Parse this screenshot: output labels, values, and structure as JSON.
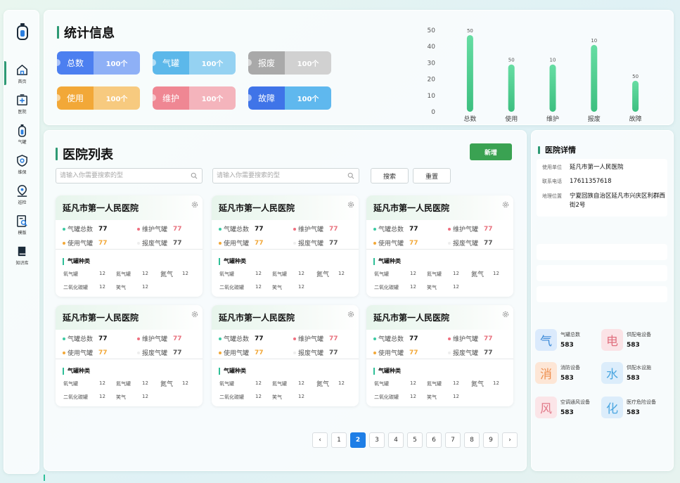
{
  "sidebar": {
    "items": [
      {
        "label": "首页",
        "icon": "home-icon",
        "active": true
      },
      {
        "label": "医院",
        "icon": "hospital-icon"
      },
      {
        "label": "气罐",
        "icon": "gas-tank-icon"
      },
      {
        "label": "维保",
        "icon": "maintenance-icon"
      },
      {
        "label": "巡检",
        "icon": "inspection-icon"
      },
      {
        "label": "模版",
        "icon": "template-icon"
      },
      {
        "label": "知识库",
        "icon": "book-icon"
      }
    ]
  },
  "stats": {
    "title": "统计信息",
    "pills": [
      {
        "label": "总数",
        "value": "100个",
        "left_color": "#4c7ff0",
        "right_color": "#8eb0f6"
      },
      {
        "label": "气罐",
        "value": "100个",
        "left_color": "#5cb8ea",
        "right_color": "#95d2f2"
      },
      {
        "label": "报废",
        "value": "100个",
        "left_color": "#a9a9a9",
        "right_color": "#d1d1d1"
      },
      {
        "label": "使用",
        "value": "100个",
        "left_color": "#f2a838",
        "right_color": "#f7ca7f"
      },
      {
        "label": "维护",
        "value": "100个",
        "left_color": "#ef8793",
        "right_color": "#f4b4bc"
      },
      {
        "label": "故障",
        "value": "100个",
        "left_color": "#3f74e8",
        "right_color": "#5fb8ee"
      }
    ]
  },
  "chart_data": {
    "type": "bar",
    "categories": [
      "总数",
      "使用",
      "维护",
      "报废",
      "故障"
    ],
    "values": [
      47,
      29,
      29,
      41,
      19
    ],
    "data_labels": [
      "50",
      "50",
      "10",
      "10",
      "50"
    ],
    "ylim": [
      0,
      50
    ],
    "yticks": [
      0,
      10,
      20,
      30,
      40,
      50
    ],
    "grid": false,
    "bar_color": "#3dbf80"
  },
  "list": {
    "title": "医院列表",
    "add_label": "新增",
    "search_placeholder_1": "请输入你需要搜索的型",
    "search_placeholder_2": "请输入你需要搜索的型",
    "search_label": "搜索",
    "reset_label": "重置",
    "card_stat_labels": {
      "total": "气罐总数",
      "maint": "维护气罐",
      "use": "使用气罐",
      "scrap": "报废气罐"
    },
    "kind_title": "气罐种类",
    "gas_labels": {
      "o2": "氧气罐",
      "n2": "氮气罐",
      "n": "氮气",
      "co2": "二氧化碳罐",
      "n2o": "笑气"
    },
    "cards": [
      {
        "name": "延凡市第一人民医院",
        "total": "77",
        "maint": "77",
        "use": "77",
        "scrap": "77",
        "o2": "12",
        "n2": "12",
        "n": "12",
        "co2": "12",
        "n2o": "12"
      },
      {
        "name": "延凡市第一人民医院",
        "total": "77",
        "maint": "77",
        "use": "77",
        "scrap": "77",
        "o2": "12",
        "n2": "12",
        "n": "12",
        "co2": "12",
        "n2o": "12"
      },
      {
        "name": "延凡市第一人民医院",
        "total": "77",
        "maint": "77",
        "use": "77",
        "scrap": "77",
        "o2": "12",
        "n2": "12",
        "n": "12",
        "co2": "12",
        "n2o": "12"
      },
      {
        "name": "延凡市第一人民医院",
        "total": "77",
        "maint": "77",
        "use": "77",
        "scrap": "77",
        "o2": "12",
        "n2": "12",
        "n": "12",
        "co2": "12",
        "n2o": "12"
      },
      {
        "name": "延凡市第一人民医院",
        "total": "77",
        "maint": "77",
        "use": "77",
        "scrap": "77",
        "o2": "12",
        "n2": "12",
        "n": "12",
        "co2": "12",
        "n2o": "12"
      },
      {
        "name": "延凡市第一人民医院",
        "total": "77",
        "maint": "77",
        "use": "77",
        "scrap": "77",
        "o2": "12",
        "n2": "12",
        "n": "12",
        "co2": "12",
        "n2o": "12"
      }
    ],
    "pagination": {
      "prev": "‹",
      "next": "›",
      "pages": [
        "1",
        "2",
        "3",
        "4",
        "5",
        "6",
        "7",
        "8",
        "9"
      ],
      "current": "2"
    }
  },
  "detail": {
    "title": "医院详情",
    "unit_label": "使用单位",
    "unit_value": "延凡市第一人民医院",
    "phone_label": "联系电话",
    "phone_value": "17611357618",
    "address_label": "地理位置",
    "address_value": "宁夏回族自治区延凡市兴庆区利群西街2号",
    "equipment": [
      {
        "char": "气",
        "label": "气罐总数",
        "value": "583",
        "bg": "#dbeafc",
        "fg": "#3c8ad8"
      },
      {
        "char": "电",
        "label": "供配电设备",
        "value": "583",
        "bg": "#fbe3e6",
        "fg": "#e0707f"
      },
      {
        "char": "消",
        "label": "消防设备",
        "value": "583",
        "bg": "#fde6d6",
        "fg": "#ee8f4f"
      },
      {
        "char": "水",
        "label": "供配水设施",
        "value": "583",
        "bg": "#dcedfb",
        "fg": "#4aa6e0"
      },
      {
        "char": "风",
        "label": "空调通风设备",
        "value": "583",
        "bg": "#fbe5e8",
        "fg": "#e17a8a"
      },
      {
        "char": "化",
        "label": "医疗危险设备",
        "value": "583",
        "bg": "#dcedfb",
        "fg": "#4aa6e0"
      }
    ]
  }
}
